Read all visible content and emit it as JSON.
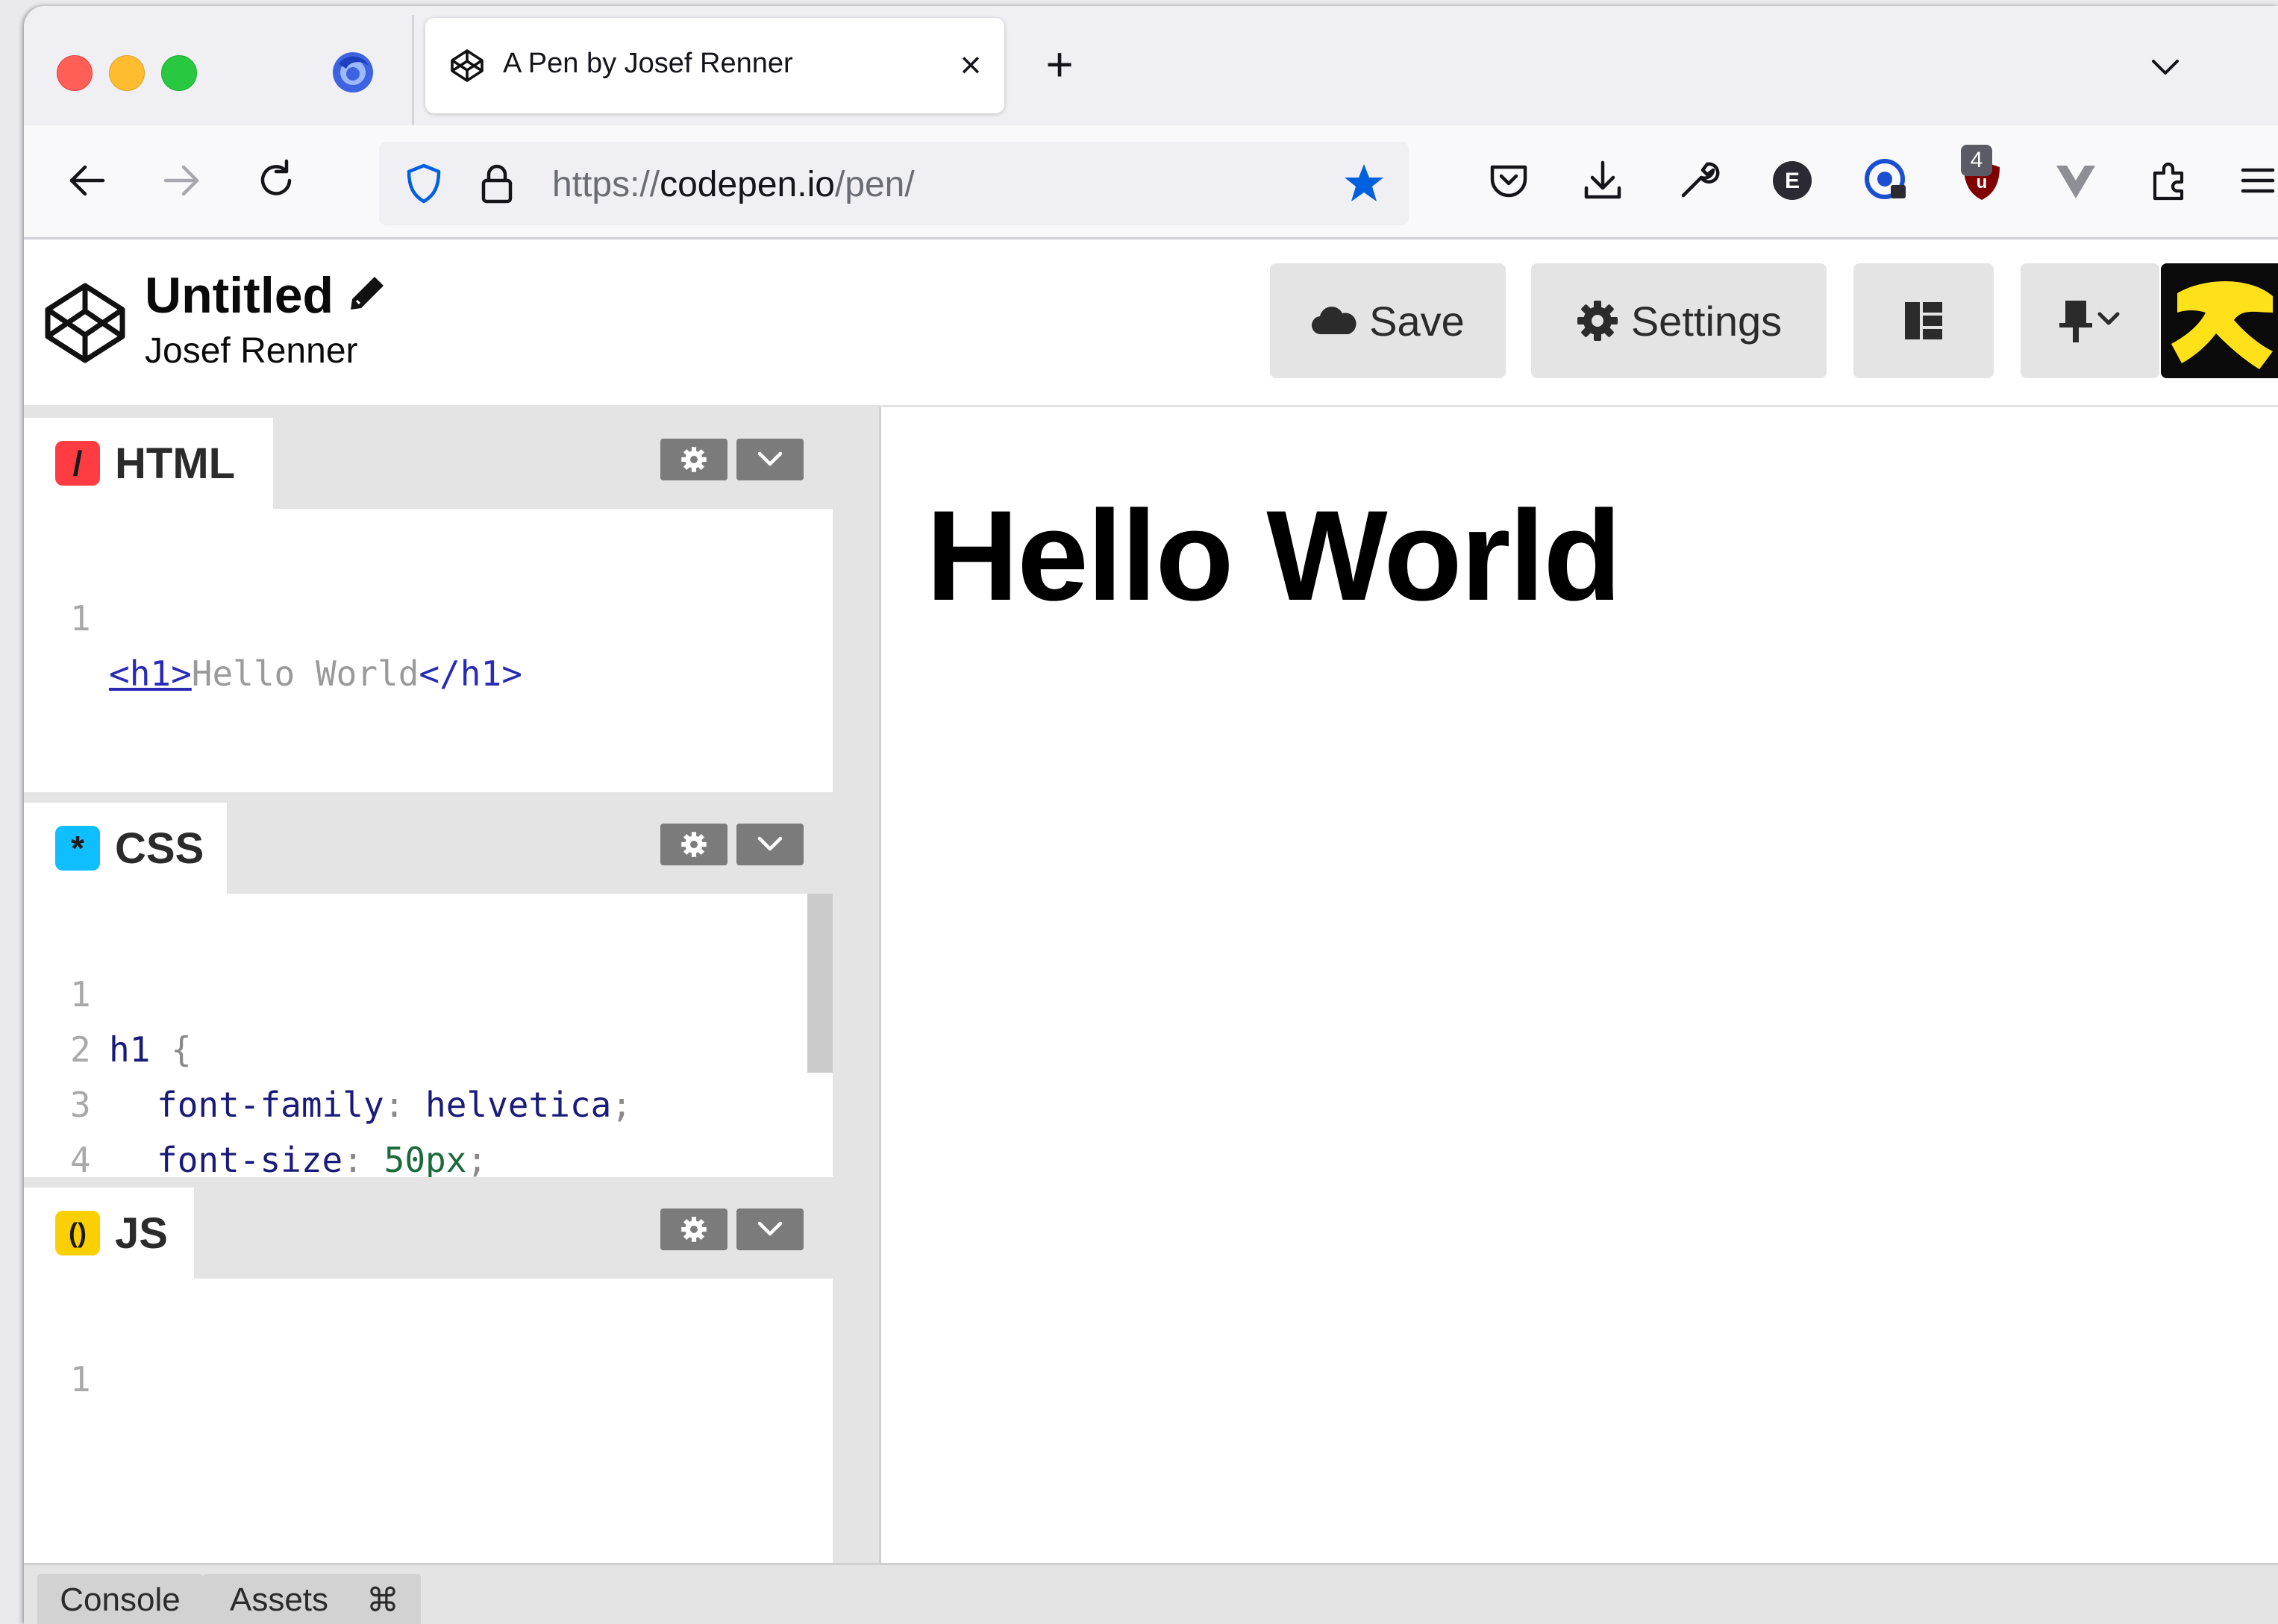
{
  "browser": {
    "tab": {
      "title": "A Pen by Josef Renner",
      "close": "×"
    },
    "new_tab": "+",
    "url": {
      "scheme": "https://",
      "host": "codepen.io",
      "path": "/pen/"
    },
    "extension_badge": "4"
  },
  "codepen": {
    "title": "Untitled",
    "author": "Josef Renner",
    "buttons": {
      "save": "Save",
      "settings": "Settings"
    }
  },
  "editors": {
    "html": {
      "name": "HTML",
      "icon_glyph": "/",
      "lines": [
        {
          "num": "1",
          "open": "<h1>",
          "text": "Hello World",
          "close": "</h1>"
        }
      ]
    },
    "css": {
      "name": "CSS",
      "icon_glyph": "*",
      "lines": [
        {
          "num": "1",
          "selector": "h1",
          "punc": " {"
        },
        {
          "num": "2",
          "prop": "font-family",
          "colon": ": ",
          "value": "helvetica",
          "semi": ";"
        },
        {
          "num": "3",
          "prop": "font-size",
          "colon": ": ",
          "value": "50px",
          "semi": ";"
        },
        {
          "num": "4",
          "punc": "}"
        }
      ]
    },
    "js": {
      "name": "JS",
      "icon_glyph": "()",
      "lines": [
        {
          "num": "1"
        }
      ]
    }
  },
  "preview": {
    "heading": "Hello World"
  },
  "footer": {
    "console": "Console",
    "assets": "Assets",
    "shortcuts": "⌘"
  },
  "colors": {
    "html_icon": "#ff3c41",
    "css_icon": "#0ebeff",
    "js_icon": "#fcd000",
    "bookmark_star": "#0060df",
    "ublock": "#800000"
  }
}
